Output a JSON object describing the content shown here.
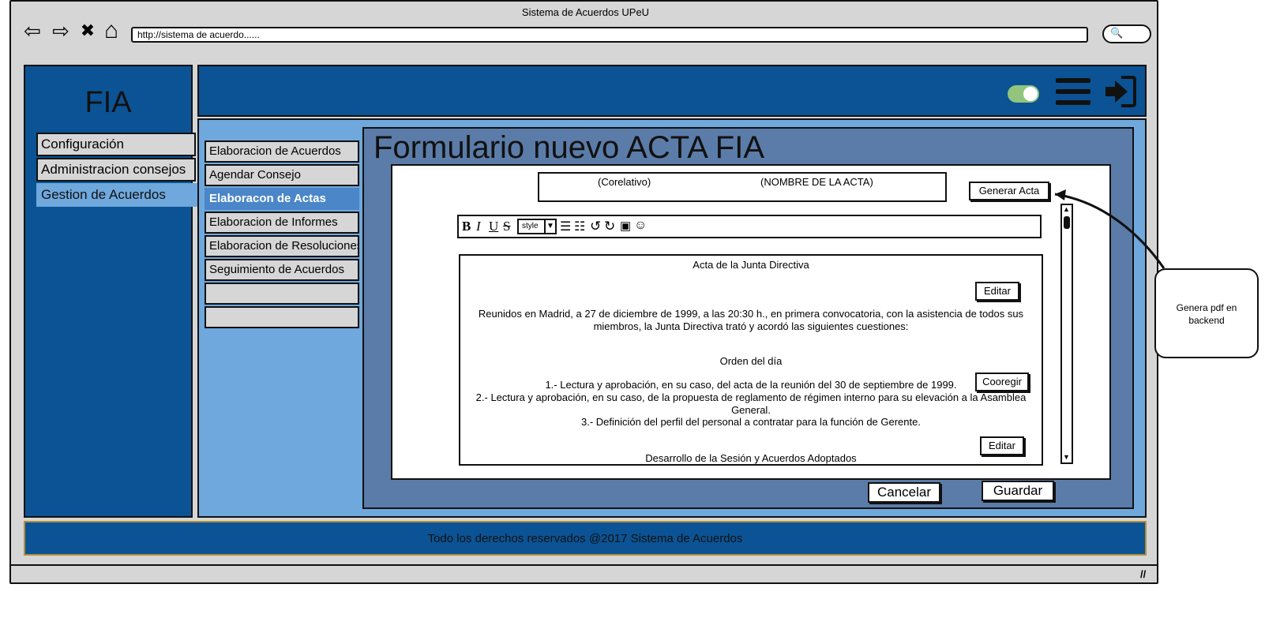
{
  "window": {
    "title": "Sistema de Acuerdos UPeU"
  },
  "browser": {
    "nav_icons": [
      "back-arrow",
      "forward-arrow",
      "close-x",
      "home"
    ],
    "url": "http://sistema de acuerdo......",
    "search_icon": "magnifier",
    "back_glyph": "⇦",
    "forward_glyph": "⇨",
    "stop_glyph": "✖",
    "home_glyph": "⌂",
    "search_glyph": "🔍",
    "resize_glyph": "//"
  },
  "sidebar": {
    "logo": "FIA",
    "items": [
      {
        "label": "Configuración",
        "active": false
      },
      {
        "label": "Administracion consejos",
        "active": false
      },
      {
        "label": "Gestion de Acuerdos",
        "active": true
      }
    ]
  },
  "header": {
    "icons": [
      "toggle-switch",
      "hamburger-menu",
      "logout"
    ],
    "toggle_on": true,
    "colors": {
      "brand": "#0b5394",
      "panel": "#6fa8dc",
      "form_panel": "#5b7ca8",
      "toggle": "#93c47d"
    }
  },
  "submenu": {
    "items": [
      {
        "label": "Elaboracion de Acuerdos",
        "active": false
      },
      {
        "label": "Agendar Consejo",
        "active": false
      },
      {
        "label": "Elaboracon de Actas",
        "active": true
      },
      {
        "label": "Elaboracion de Informes",
        "active": false
      },
      {
        "label": "Elaboracion de Resoluciones",
        "active": false
      },
      {
        "label": "Seguimiento de Acuerdos",
        "active": false
      },
      {
        "label": "",
        "active": false
      },
      {
        "label": "",
        "active": false
      }
    ]
  },
  "form": {
    "title": "Formulario nuevo ACTA FIA",
    "correlativo": "(Corelativo)",
    "nombre_acta": "(NOMBRE DE LA ACTA)",
    "generate_button": "Generar Acta",
    "toolbar": {
      "bold": "B",
      "italic": "I",
      "underline": "U",
      "strike": "S",
      "style_select": "style",
      "style_arrow": "▼",
      "icons": [
        "bullet-list",
        "numbered-list",
        "undo",
        "redo",
        "image",
        "emoji"
      ],
      "bullet_glyph": "☰",
      "numbered_glyph": "☷",
      "undo_glyph": "↺",
      "redo_glyph": "↻",
      "image_glyph": "▣",
      "emoji_glyph": "☺"
    },
    "document": {
      "heading": "Acta de la Junta Directiva",
      "intro_line1": "Reunidos en Madrid, a 27 de diciembre de 1999, a las 20:30 h., en primera convocatoria, con la asistencia de todos sus",
      "intro_line2": "miembros, la Junta Directiva trató y acordó las siguientes cuestiones:",
      "agenda_heading": "Orden del día",
      "agenda_item1": "1.- Lectura y aprobación, en su caso, del acta de la reunión del 30 de septiembre de 1999.",
      "agenda_item2a": "2.- Lectura y aprobación, en su caso, de la propuesta de reglamento de régimen interno para su elevación a la Asamblea",
      "agenda_item2b": "General.",
      "agenda_item3": "3.- Definición del perfil del personal a contratar para la función de Gerente.",
      "development_heading": "Desarrollo de la Sesión y Acuerdos Adoptados",
      "edit_button_1": "Editar",
      "correct_button": "Cooregir",
      "edit_button_2": "Editar"
    },
    "scroll_up_glyph": "▲",
    "scroll_down_glyph": "▼",
    "cancel_button": "Cancelar",
    "save_button": "Guardar"
  },
  "footer": {
    "text": "Todo los derechos reservados @2017 Sistema de Acuerdos"
  },
  "callout": {
    "text": "Genera pdf en backend"
  }
}
